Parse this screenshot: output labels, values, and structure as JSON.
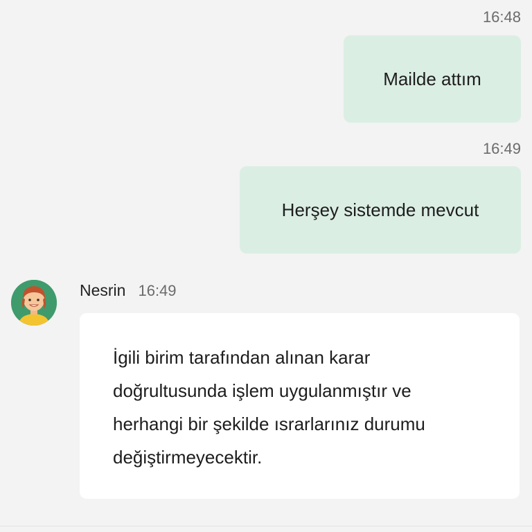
{
  "messages": [
    {
      "time": "16:48",
      "text": "Mailde attım"
    },
    {
      "time": "16:49",
      "text": "Herşey sistemde mevcut"
    }
  ],
  "incoming": {
    "sender": "Nesrin",
    "time": "16:49",
    "lines": [
      "İgili birim tarafından alınan karar",
      "doğrultusunda işlem uygulanmıştır ve",
      "herhangi bir şekilde ısrarlarınız durumu",
      "değiştirmeyecektir."
    ]
  },
  "colors": {
    "background": "#f3f3f3",
    "outgoing_bubble": "#dbeee4",
    "incoming_bubble": "#ffffff",
    "avatar_bg": "#3f9b6c"
  }
}
